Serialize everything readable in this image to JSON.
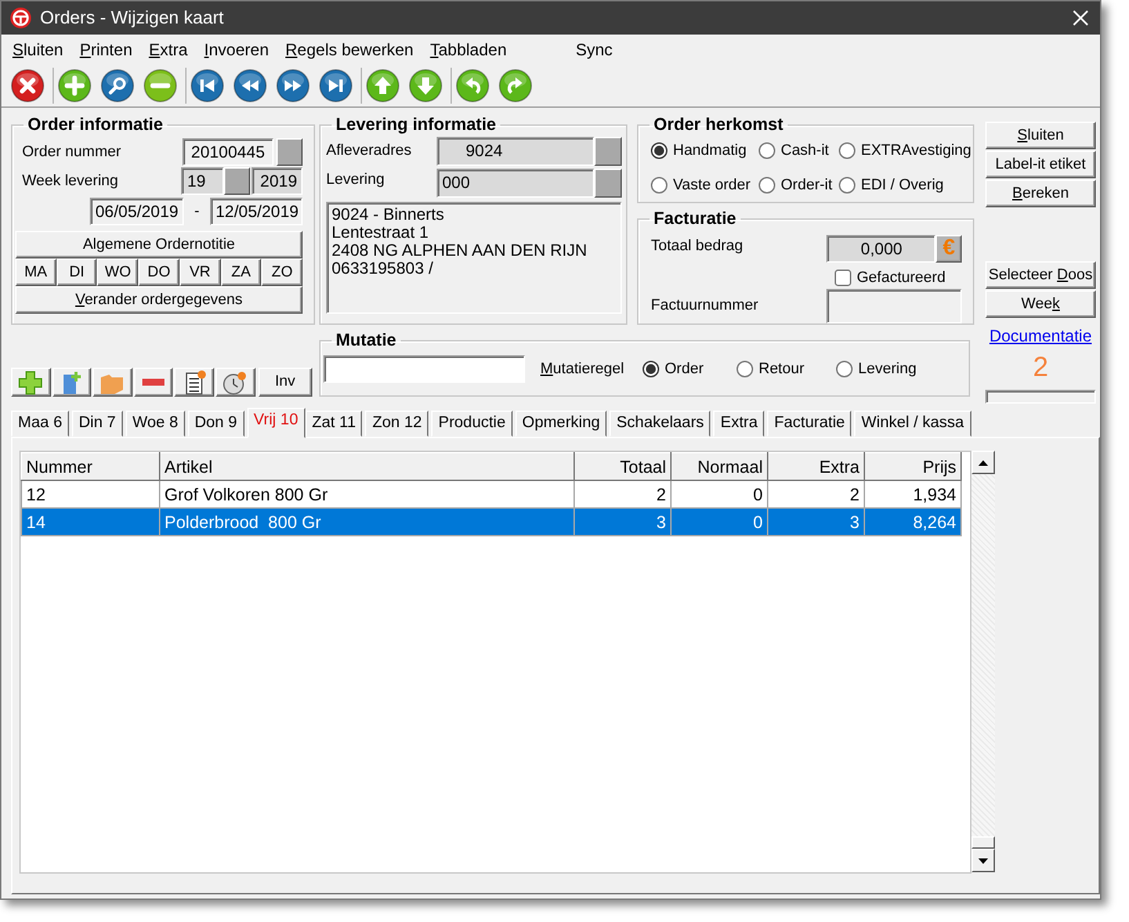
{
  "window": {
    "title": "Orders - Wijzigen kaart"
  },
  "menu": [
    {
      "key": "S",
      "after": "luiten"
    },
    {
      "key": "P",
      "after": "rinten"
    },
    {
      "key": "E",
      "after": "xtra"
    },
    {
      "key": "I",
      "after": "nvoeren"
    },
    {
      "key": "R",
      "after": "egels bewerken"
    },
    {
      "key": "T",
      "after": "abbladen"
    },
    {
      "before": "Sync"
    }
  ],
  "toolbar": [
    [
      {
        "kind": "close"
      }
    ],
    [
      {
        "kind": "add"
      },
      {
        "kind": "search"
      },
      {
        "kind": "remove"
      }
    ],
    [
      {
        "kind": "first"
      },
      {
        "kind": "prev"
      },
      {
        "kind": "next"
      },
      {
        "kind": "last"
      }
    ],
    [
      {
        "kind": "up"
      },
      {
        "kind": "down"
      }
    ],
    [
      {
        "kind": "undo"
      },
      {
        "kind": "redo"
      }
    ]
  ],
  "order_info": {
    "title": "Order informatie",
    "order_label": "Order nummer",
    "order_number": "20100445",
    "week_label": "Week levering",
    "week": "19",
    "year": "2019",
    "date_from": "06/05/2019",
    "date_separator": "-",
    "date_to": "12/05/2019",
    "note_button": "Algemene Ordernotitie",
    "days": [
      "MA",
      "DI",
      "WO",
      "DO",
      "VR",
      "ZA",
      "ZO"
    ],
    "change_button": {
      "key": "V",
      "after": "erander ordergegevens"
    }
  },
  "delivery_info": {
    "title": "Levering informatie",
    "address_label": "Afleveradres",
    "address_code": "9024",
    "delivery_label": "Levering",
    "delivery_code": "000",
    "address_lines": [
      "9024 - Binnerts",
      "Lentestraat 1",
      "2408 NG ALPHEN AAN DEN RIJN",
      "0633195803 /"
    ]
  },
  "origin": {
    "title": "Order herkomst",
    "options": [
      {
        "label": "Handmatig",
        "selected": true
      },
      {
        "label": "Cash-it",
        "selected": false
      },
      {
        "label": "EXTRAvestiging",
        "selected": false
      },
      {
        "label": "Vaste order",
        "selected": false
      },
      {
        "label": "Order-it",
        "selected": false
      },
      {
        "label": "EDI / Overig",
        "selected": false
      }
    ]
  },
  "invoicing": {
    "title": "Facturatie",
    "total_label": "Totaal bedrag",
    "total": "0,000",
    "currency_button": "€",
    "invoiced": {
      "label": "Gefactureerd",
      "checked": false
    },
    "invoice_number_label": "Factuurnummer"
  },
  "side_buttons": [
    {
      "key": "S",
      "after": "luiten"
    },
    {
      "before": "Label-it etiket"
    },
    {
      "key": "B",
      "after": "ereken"
    }
  ],
  "side_buttons_2": [
    {
      "before": "Selecteer ",
      "key": "D",
      "after": "oos"
    },
    {
      "before": "Wee",
      "key": "k"
    }
  ],
  "documentation_link": "Documentatie",
  "counter": "2",
  "line_tools": [
    {
      "kind": "add"
    },
    {
      "kind": "add-sheet"
    },
    {
      "kind": "folder"
    },
    {
      "kind": "remove"
    },
    {
      "kind": "list-add"
    },
    {
      "kind": "clock-add"
    },
    {
      "kind": "text",
      "label": "Inv"
    }
  ],
  "mutation": {
    "title": "Mutatie",
    "line_label": {
      "key": "M",
      "after": "utatieregel"
    },
    "types": [
      {
        "label": "Order",
        "selected": true
      },
      {
        "label": "Retour",
        "selected": false
      },
      {
        "label": "Levering",
        "selected": false
      }
    ]
  },
  "tabs": [
    {
      "label": "Maa 6",
      "selected": false
    },
    {
      "label": "Din 7",
      "selected": false
    },
    {
      "label": "Woe 8",
      "selected": false
    },
    {
      "label": "Don 9",
      "selected": false
    },
    {
      "label": "Vrij 10",
      "selected": true
    },
    {
      "label": "Zat 11",
      "selected": false
    },
    {
      "label": "Zon 12",
      "selected": false
    },
    {
      "label": "Productie",
      "selected": false
    },
    {
      "label": "Opmerking",
      "selected": false
    },
    {
      "label": "Schakelaars",
      "selected": false
    },
    {
      "label": "Extra",
      "selected": false
    },
    {
      "label": "Facturatie",
      "selected": false
    },
    {
      "label": "Winkel / kassa",
      "selected": false
    }
  ],
  "table": {
    "columns": [
      {
        "label": "Nummer"
      },
      {
        "label": "Artikel"
      },
      {
        "label": "Totaal"
      },
      {
        "label": "Normaal"
      },
      {
        "label": "Extra"
      },
      {
        "label": "Prijs"
      }
    ],
    "rows": [
      {
        "cells": [
          "12",
          "Grof Volkoren 800 Gr",
          "2",
          "0",
          "2",
          "1,934"
        ],
        "selected": false
      },
      {
        "cells": [
          "14",
          "Polderbrood  800 Gr",
          "3",
          "0",
          "3",
          "8,264"
        ],
        "selected": true
      }
    ]
  }
}
